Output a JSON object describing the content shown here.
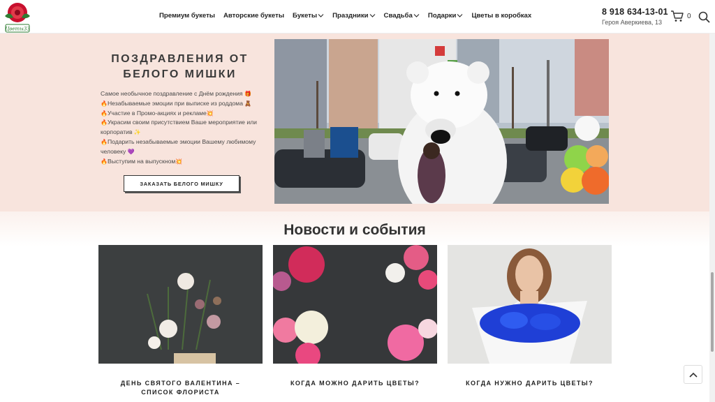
{
  "header": {
    "logo_text": "Цветы33",
    "nav": [
      {
        "label": "Премиум букеты",
        "dropdown": false
      },
      {
        "label": "Авторские букеты",
        "dropdown": false
      },
      {
        "label": "Букеты",
        "dropdown": true
      },
      {
        "label": "Праздники",
        "dropdown": true
      },
      {
        "label": "Свадьба",
        "dropdown": true
      },
      {
        "label": "Подарки",
        "dropdown": true
      },
      {
        "label": "Цветы в коробках",
        "dropdown": false
      }
    ],
    "phone": "8 918 634-13-01",
    "address": "Героя Аверкиева, 13",
    "cart_count": "0"
  },
  "promo": {
    "title_line1": "ПОЗДРАВЛЕНИЯ ОТ",
    "title_line2": "БЕЛОГО МИШКИ",
    "items": [
      "Самое необычное поздравление с Днём рождения",
      "Незабываемые эмоции при выписке из роддома",
      "Участие в Промо-акциях и рекламе",
      "Украсим своим присутствием Ваше мероприятие или корпоратив",
      "Подарить незабываемые эмоции Вашему любимому человеку",
      "Выступим на выпускном"
    ],
    "button_label": "ЗАКАЗАТЬ БЕЛОГО МИШКУ"
  },
  "news": {
    "title": "Новости и события",
    "cards": [
      {
        "caption": "ДЕНЬ СВЯТОГО ВАЛЕНТИНА – СПИСОК ФЛОРИСТА"
      },
      {
        "caption": "КОГДА МОЖНО ДАРИТЬ ЦВЕТЫ?"
      },
      {
        "caption": "КОГДА НУЖНО ДАРИТЬ ЦВЕТЫ?"
      }
    ]
  },
  "colors": {
    "promo_bg": "#f8e4dd",
    "text_dark": "#222222",
    "accent_fire": "#e8871e"
  }
}
